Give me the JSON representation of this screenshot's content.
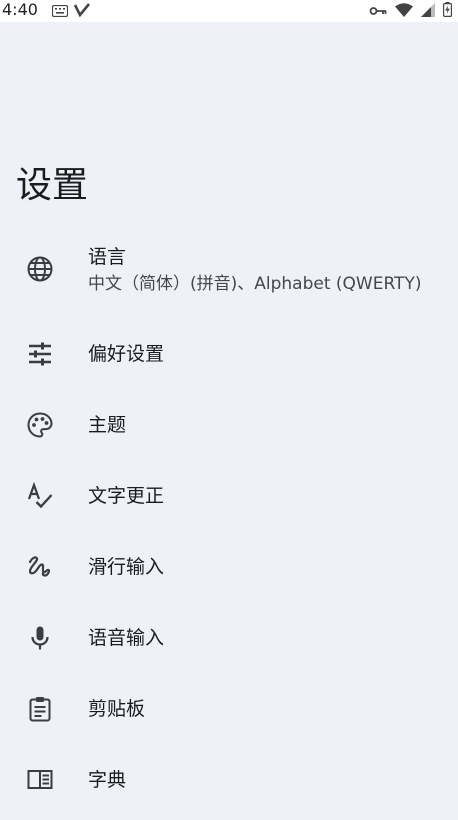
{
  "status_bar": {
    "time": "4:40",
    "left_icons": [
      "keyboard-icon",
      "v-app-icon"
    ],
    "right_icons": [
      "vpn-key-icon",
      "wifi-icon",
      "cell-signal-icon",
      "battery-charging-icon"
    ]
  },
  "page": {
    "title": "设置"
  },
  "settings": {
    "items": [
      {
        "icon": "globe-icon",
        "label": "语言",
        "sublabel": "中文（简体）(拼音)、Alphabet (QWERTY)"
      },
      {
        "icon": "tune-icon",
        "label": "偏好设置"
      },
      {
        "icon": "palette-icon",
        "label": "主题"
      },
      {
        "icon": "spellcheck-icon",
        "label": "文字更正"
      },
      {
        "icon": "gesture-icon",
        "label": "滑行输入"
      },
      {
        "icon": "mic-icon",
        "label": "语音输入"
      },
      {
        "icon": "clipboard-icon",
        "label": "剪贴板"
      },
      {
        "icon": "dictionary-icon",
        "label": "字典"
      }
    ]
  },
  "colors": {
    "background": "#eef2f8",
    "status_bar": "#ffffff",
    "text_primary": "#1b1c1e",
    "text_secondary": "#45474b",
    "icon": "#3b3d40"
  }
}
